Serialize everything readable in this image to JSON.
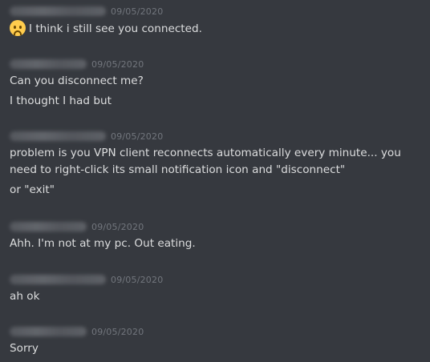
{
  "messages": [
    {
      "timestamp": "09/05/2020",
      "emoji": "slightly-frowning-face-emoji",
      "lines": [
        "I think i still see you connected."
      ]
    },
    {
      "timestamp": "09/05/2020",
      "lines": [
        "Can you disconnect me?",
        "I thought I had but"
      ]
    },
    {
      "timestamp": "09/05/2020",
      "lines": [
        "problem is you VPN client reconnects automatically every minute... you need to right-click its small notification icon and \"disconnect\"",
        "or \"exit\""
      ]
    },
    {
      "timestamp": "09/05/2020",
      "lines": [
        "Ahh. I'm not at my pc. Out eating."
      ]
    },
    {
      "timestamp": "09/05/2020",
      "lines": [
        "ah ok"
      ]
    },
    {
      "timestamp": "09/05/2020",
      "lines": [
        "Sorry"
      ]
    }
  ]
}
